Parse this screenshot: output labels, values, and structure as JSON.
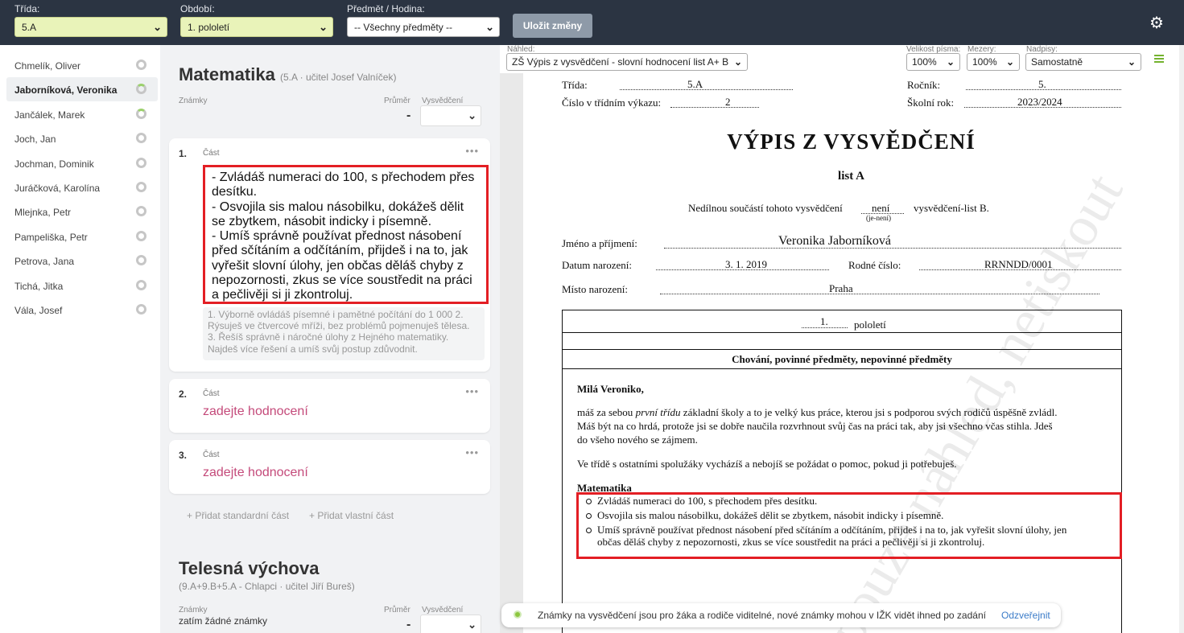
{
  "toolbar": {
    "trida_label": "Třída:",
    "trida_value": "5.A",
    "obdobi_label": "Období:",
    "obdobi_value": "1. pololetí",
    "predmet_label": "Předmět / Hodina:",
    "predmet_value": "-- Všechny předměty --",
    "save_label": "Uložit změny"
  },
  "students": [
    {
      "name": "Chmelík, Oliver"
    },
    {
      "name": "Jaborníková, Veronika"
    },
    {
      "name": "Jančálek, Marek"
    },
    {
      "name": "Joch, Jan"
    },
    {
      "name": "Jochman, Dominik"
    },
    {
      "name": "Juráčková, Karolína"
    },
    {
      "name": "Mlejnka, Petr"
    },
    {
      "name": "Pampeliška, Petr"
    },
    {
      "name": "Petrova, Jana"
    },
    {
      "name": "Tichá, Jitka"
    },
    {
      "name": "Vála, Josef"
    }
  ],
  "subject1": {
    "title": "Matematika",
    "meta": "(5.A · učitel Josef Valníček)",
    "znamky": "Známky",
    "prumer": "Průměr",
    "vysvedceni": "Vysvědčení",
    "avg": "-",
    "cards": [
      {
        "num": "1.",
        "part": "Část",
        "text": "- Zvládáš numeraci do 100, s přechodem přes desítku.\n- Osvojila sis malou násobilku, dokážeš dělit se zbytkem, násobit indicky i písemně.\n- Umíš správně používat přednost násobení před sčítáním a odčítáním, přijdeš i na to, jak vyřešit slovní úlohy, jen občas děláš chyby z nepozornosti, zkus se více soustředit na práci a pečlivěji si ji zkontroluj.",
        "past": "1. Výborně ovládáš písemné i pamětné počítání do 1 000 2. Rýsuješ ve čtvercové mříži, bez problémů pojmenuješ tělesa. 3. Řešíš správně i náročné úlohy z Hejného matematiky. Najdeš více řešení a umíš svůj postup zdůvodnit."
      },
      {
        "num": "2.",
        "part": "Část",
        "empty": "zadejte hodnocení"
      },
      {
        "num": "3.",
        "part": "Část",
        "empty": "zadejte hodnocení"
      }
    ],
    "add_std": "Přidat standardní část",
    "add_own": "Přidat vlastní část"
  },
  "subject2": {
    "title": "Telesná výchova",
    "meta": "(9.A+9.B+5.A - Chlapci · učitel Jiří Bureš)",
    "znamky": "Známky",
    "prumer": "Průměr",
    "vysvedceni": "Vysvědčení",
    "avg": "-",
    "no_grades": "zatím žádné známky"
  },
  "preview_bar": {
    "nahled_label": "Náhled:",
    "nahled_value": "ZŠ Výpis z vysvědčení - slovní hodnocení list A+ B",
    "font_label": "Velikost písma:",
    "font_value": "100%",
    "gap_label": "Mezery:",
    "gap_value": "100%",
    "head_label": "Nadpisy:",
    "head_value": "Samostatně"
  },
  "doc": {
    "trida_l": "Třída:",
    "trida_v": "5.A",
    "rocnik_l": "Ročník:",
    "rocnik_v": "5.",
    "cislo_l": "Číslo v třídním výkazu:",
    "cislo_v": "2",
    "rok_l": "Školní rok:",
    "rok_v": "2023/2024",
    "title": "VÝPIS Z VYSVĚDČENÍ",
    "subtitle": "list A",
    "nedil_a": "Nedílnou součástí tohoto vysvědčení",
    "nedil_v": "není",
    "nedil_sub": "(je-není)",
    "nedil_b": "vysvědčení-list B.",
    "jmeno_l": "Jméno a příjmení:",
    "jmeno_v": "Veronika Jaborníková",
    "datum_l": "Datum narození:",
    "datum_v": "3. 1. 2019",
    "rodne_l": "Rodné číslo:",
    "rodne_v": "RRNNDD/0001",
    "misto_l": "Místo narození:",
    "misto_v": "Praha",
    "pol_v": "1.",
    "pol_l": "pololetí",
    "section": "Chování, povinné předměty, nepovinné předměty",
    "greeting": "Milá Veroniko,",
    "p1a": "máš za sebou",
    "p1b": "první třídu",
    "p1c": "základní školy a to je velký kus práce, kterou jsi s podporou svých rodičů úspěšně zvládl.",
    "p1d": "Máš být na co hrdá, protože  jsi se  dobře naučila rozvrhnout svůj čas na práci tak, aby jsi všechno včas stihla. Jdeš",
    "p1e": "do všeho nového se zájmem.",
    "p2": "Ve třídě s ostatními spolužáky vycházíš  a nebojíš se požádat o pomoc, pokud ji potřebuješ.",
    "subj": "Matematika",
    "b1": "Zvládáš numeraci do 100, s přechodem přes desítku.",
    "b2": "Osvojila sis malou násobilku, dokážeš dělit se zbytkem, násobit indicky i písemně.",
    "b3a": "Umíš správně používat přednost násobení před sčítáním a odčítáním, přijdeš i na to, jak vyřešit slovní úlohy, jen",
    "b3b": "občas děláš chyby z nepozornosti, zkus se více soustředit na práci a pečlivěji si ji zkontroluj.",
    "watermark": "pouze náhled, netiskout"
  },
  "toast": {
    "text": "Známky na vysvědčení jsou pro žáka a rodiče viditelné, nové známky mohou v IŽK vidět ihned po zadání",
    "link": "Odzveřejnit"
  }
}
